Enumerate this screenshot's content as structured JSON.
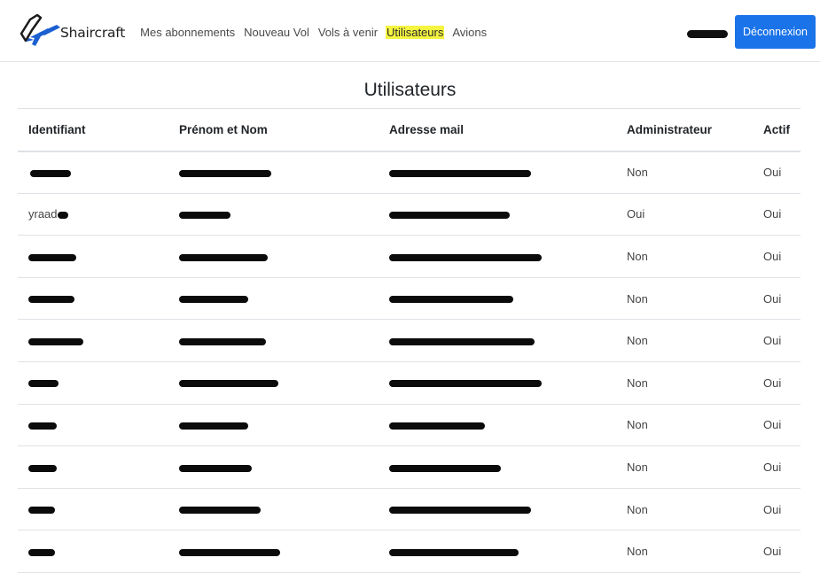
{
  "navbar": {
    "brand": "Shaircraft",
    "links": [
      {
        "label": "Mes abonnements"
      },
      {
        "label": "Nouveau Vol"
      },
      {
        "label": "Vols à venir"
      },
      {
        "label": "Utilisateurs"
      },
      {
        "label": "Avions"
      }
    ],
    "active_link": "Utilisateurs",
    "logout_label": "Déconnexion",
    "logout_color": "#1a73e8",
    "highlight_color": "#f5f541"
  },
  "page": {
    "title": "Utilisateurs"
  },
  "table": {
    "headers": [
      "Identifiant",
      "Prénom et Nom",
      "Adresse mail",
      "Administrateur",
      "Actif"
    ],
    "rows": [
      {
        "id": "",
        "name": "",
        "email": "",
        "admin": "Non",
        "active": "Oui"
      },
      {
        "id": "yraad",
        "name": "",
        "email": "",
        "admin": "Oui",
        "active": "Oui"
      },
      {
        "id": "",
        "name": "",
        "email": "",
        "admin": "Non",
        "active": "Oui"
      },
      {
        "id": "",
        "name": "",
        "email": "",
        "admin": "Non",
        "active": "Oui"
      },
      {
        "id": "",
        "name": "",
        "email": "",
        "admin": "Non",
        "active": "Oui"
      },
      {
        "id": "",
        "name": "",
        "email": "",
        "admin": "Non",
        "active": "Oui"
      },
      {
        "id": "",
        "name": "",
        "email": "",
        "admin": "Non",
        "active": "Oui"
      },
      {
        "id": "",
        "name": "",
        "email": "",
        "admin": "Non",
        "active": "Oui"
      },
      {
        "id": "",
        "name": "",
        "email": "",
        "admin": "Non",
        "active": "Oui"
      },
      {
        "id": "",
        "name": "",
        "email": "",
        "admin": "Non",
        "active": "Oui"
      }
    ]
  }
}
